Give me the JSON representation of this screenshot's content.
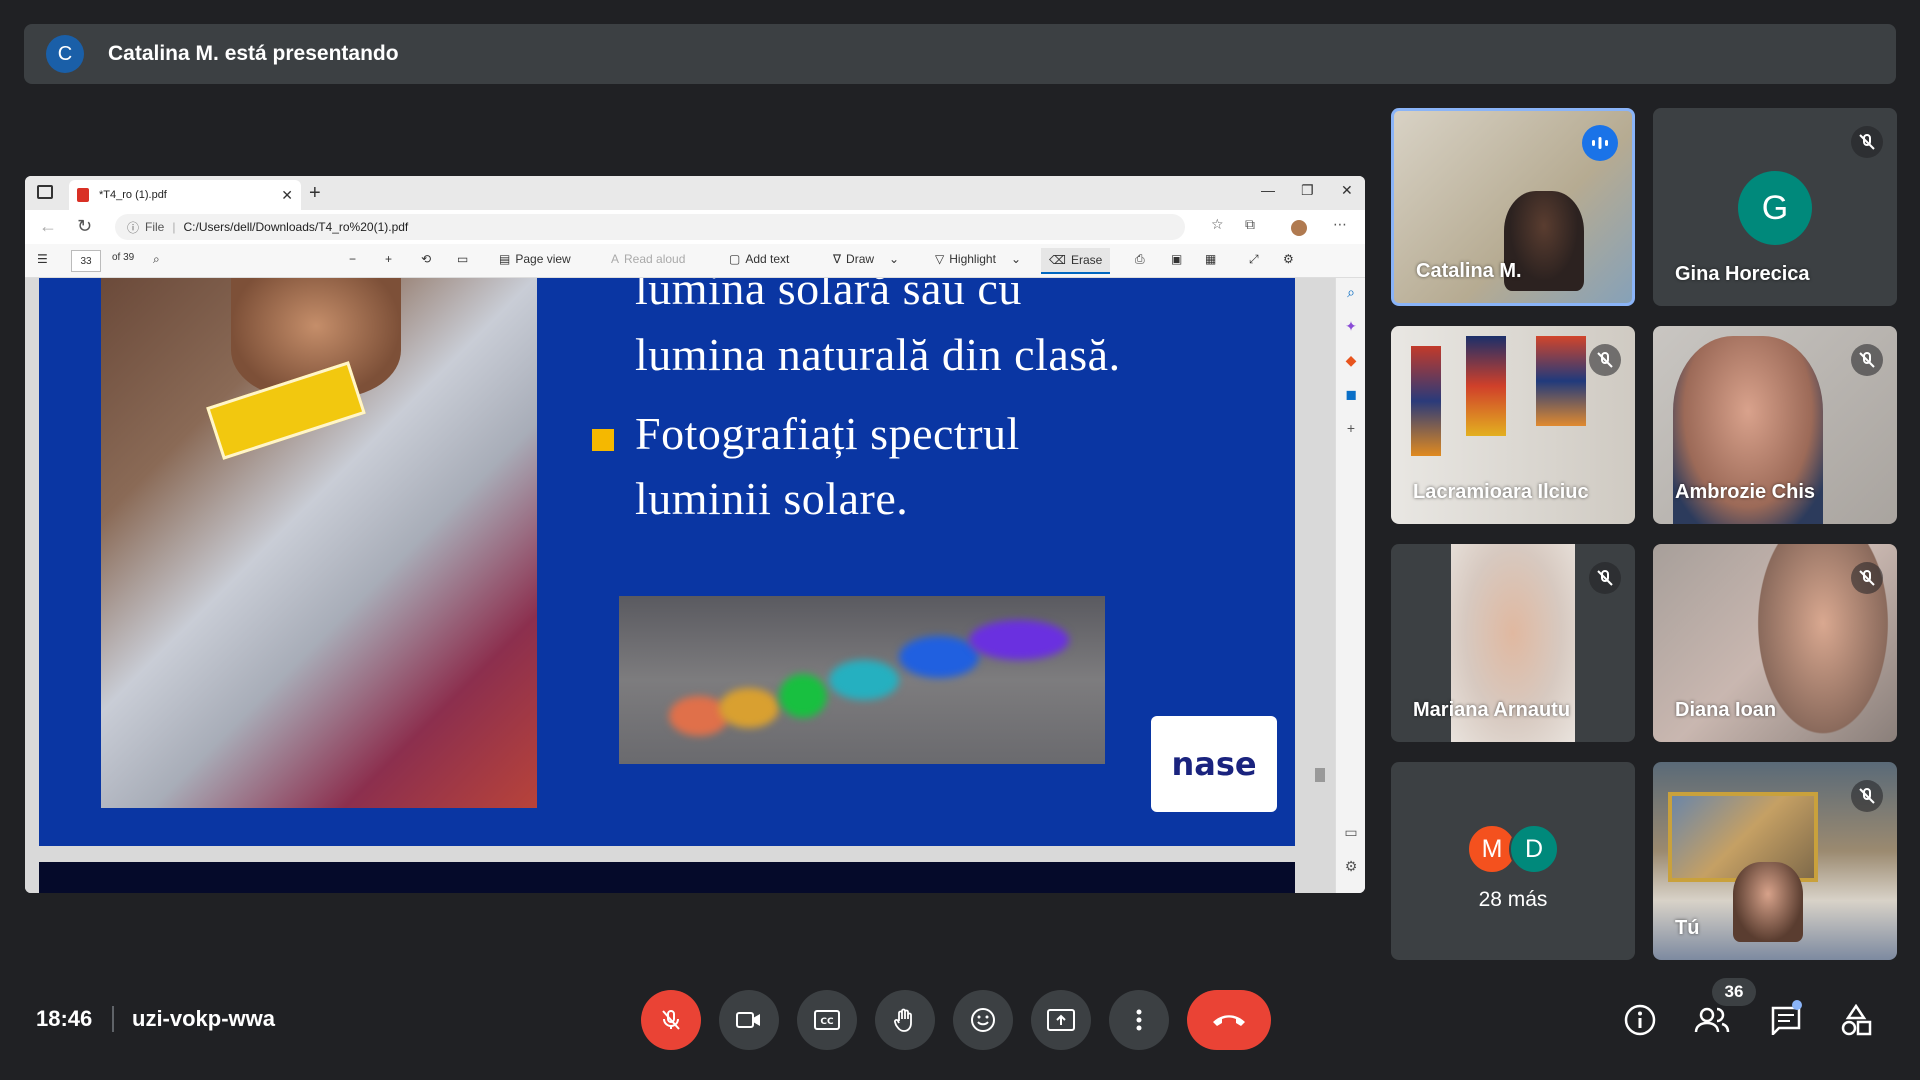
{
  "presenter_bar": {
    "avatar_letter": "C",
    "text": "Catalina M. está presentando"
  },
  "browser": {
    "tab_title": "*T4_ro (1).pdf",
    "new_tab_symbol": "+",
    "url_prefix": "File",
    "url": "C:/Users/dell/Downloads/T4_ro%20(1).pdf"
  },
  "pdf_toolbar": {
    "page_number": "33",
    "page_total": "of 39",
    "page_view": "Page view",
    "read_aloud": "Read aloud",
    "add_text": "Add text",
    "draw": "Draw",
    "highlight": "Highlight",
    "erase": "Erase"
  },
  "slide": {
    "line1": "lumina solară sau cu",
    "line2": "lumina naturală din clasă.",
    "line3": "Fotografiați spectrul",
    "line4": "luminii solare.",
    "logo_text": "nase",
    "bullet_color": "#f5b800",
    "background_color": "#0a36a3"
  },
  "participants": [
    {
      "name": "Catalina M.",
      "speaking": true
    },
    {
      "name": "Gina Horecica",
      "avatar_letter": "G",
      "avatar_color": "#00897b",
      "muted": true
    },
    {
      "name": "Lacramioara Ilciuc",
      "muted": true
    },
    {
      "name": "Ambrozie Chis",
      "muted": true
    },
    {
      "name": "Mariana Arnautu",
      "muted": true
    },
    {
      "name": "Diana Ioan",
      "muted": true
    },
    {
      "more_label": "28 más",
      "avatars": [
        {
          "letter": "M",
          "color": "#f4511e"
        },
        {
          "letter": "D",
          "color": "#00897b"
        }
      ]
    },
    {
      "name": "Tú",
      "muted": true
    }
  ],
  "bottom_bar": {
    "time": "18:46",
    "meeting_code": "uzi-vokp-wwa",
    "people_count": "36"
  },
  "colors": {
    "accent": "#1a73e8",
    "danger": "#ea4335",
    "surface": "#3c4043",
    "background": "#202124"
  }
}
